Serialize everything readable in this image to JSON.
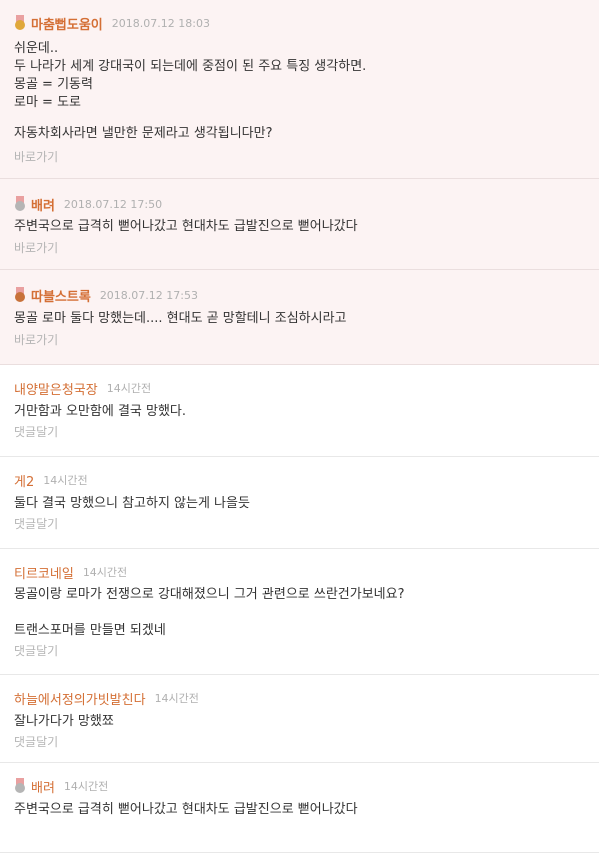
{
  "colors": {
    "nickname": "#d46f35",
    "best_bg": "#fcf3f3",
    "gold": "#e0a83a",
    "silver": "#b5b5b5",
    "bronze": "#c8723a"
  },
  "comments": [
    {
      "medal": "gold",
      "nickname": "마춤뻡도움이",
      "time": "2018.07.12 18:03",
      "lines": [
        "쉬운데..",
        "두 나라가 세계 강대국이 되는데에 중점이 된 주요 특징 생각하면.",
        "몽골 = 기동력",
        "로마 = 도로",
        "",
        "자동차회사라면 낼만한 문제라고 생각됩니다만?"
      ],
      "link": "바로가기"
    },
    {
      "medal": "silver",
      "nickname": "배려",
      "time": "2018.07.12 17:50",
      "lines": [
        "주변국으로 급격히 뻗어나갔고 현대차도 급발진으로 뻗어나갔다"
      ],
      "link": "바로가기"
    },
    {
      "medal": "bronze",
      "nickname": "따블스트록",
      "time": "2018.07.12 17:53",
      "lines": [
        "몽골 로마 둘다 망했는데.... 현대도 곧 망할테니 조심하시라고"
      ],
      "link": "바로가기"
    },
    {
      "nickname": "내양말은청국장",
      "time": "14시간전",
      "lines": [
        "거만함과 오만함에 결국 망했다."
      ],
      "link": "댓글달기"
    },
    {
      "nickname": "게2",
      "time": "14시간전",
      "lines": [
        "둘다 결국 망했으니 참고하지 않는게 나을듯"
      ],
      "link": "댓글달기"
    },
    {
      "nickname": "티르코네일",
      "time": "14시간전",
      "lines": [
        "몽골이랑 로마가 전쟁으로 강대해졌으니 그거 관련으로 쓰란건가보네요?",
        "",
        "트랜스포머를 만들면 되겠네"
      ],
      "link": "댓글달기"
    },
    {
      "nickname": "하늘에서정의가빗발친다",
      "time": "14시간전",
      "lines": [
        "잘나가다가 망했쬬"
      ],
      "link": "댓글달기"
    },
    {
      "medal": "silver",
      "nickname": "배려",
      "time": "14시간전",
      "lines": [
        "주변국으로 급격히 뻗어나갔고 현대차도 급발진으로 뻗어나갔다"
      ]
    }
  ]
}
